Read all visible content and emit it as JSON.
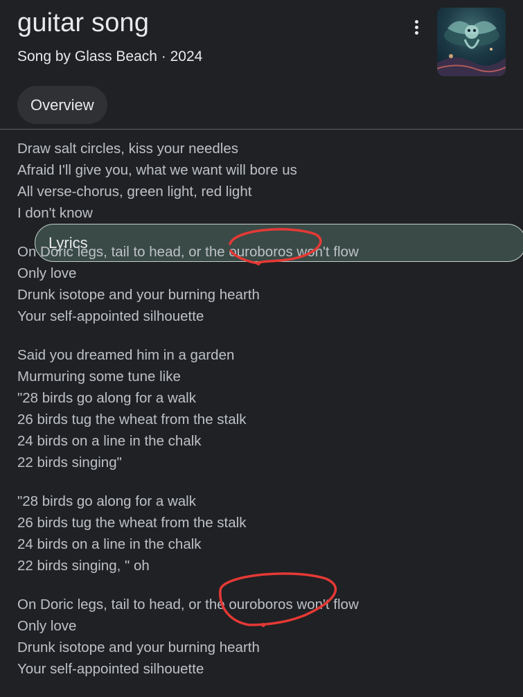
{
  "song": {
    "title": "guitar song",
    "subtitle": "Song by Glass Beach · 2024"
  },
  "menu_icon": "more-vert-icon",
  "tabs": [
    {
      "label": "Overview",
      "selected": false
    },
    {
      "label": "Lyrics",
      "selected": true
    }
  ],
  "lyrics": {
    "stanzas": [
      {
        "lines": [
          "Draw salt circles, kiss your needles",
          "Afraid I'll give you, what we want will bore us",
          "All verse-chorus, green light, red light",
          "I don't know"
        ]
      },
      {
        "lines": [
          "On Doric legs, tail to head, or the ouroboros won't flow",
          "Only love",
          "Drunk isotope and your burning hearth",
          "Your self-appointed silhouette"
        ]
      },
      {
        "lines": [
          "Said you dreamed him in a garden",
          "Murmuring some tune like",
          "\"28 birds go along for a walk",
          "26 birds tug the wheat from the stalk",
          "24 birds on a line in the chalk",
          "22 birds singing\""
        ]
      },
      {
        "lines": [
          "\"28 birds go along for a walk",
          "26 birds tug the wheat from the stalk",
          "24 birds on a line in the chalk",
          "22 birds singing, \" oh"
        ]
      },
      {
        "lines": [
          "On Doric legs, tail to head, or the ouroboros won't flow",
          "Only love",
          "Drunk isotope and your burning hearth",
          "Your self-appointed silhouette"
        ]
      }
    ]
  },
  "annotation_color": "#e53935"
}
